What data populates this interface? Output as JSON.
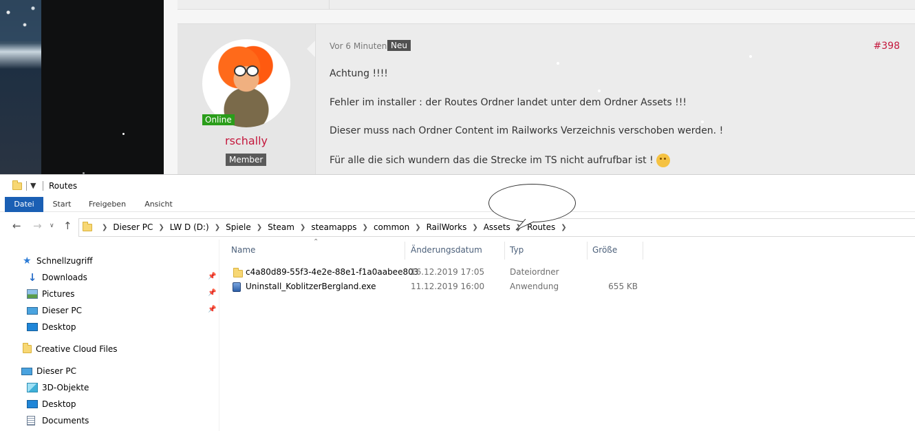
{
  "forum": {
    "post_time": "Vor 6 Minuten",
    "post_badge": "Neu",
    "post_number": "#398",
    "lines": [
      "Achtung !!!!",
      "Fehler im installer : der Routes Ordner landet unter dem Ordner Assets !!!",
      "Dieser muss nach Ordner Content im Railworks Verzeichnis verschoben werden. !",
      "Für alle die sich wundern das die Strecke im TS nicht aufrufbar ist !"
    ],
    "user": {
      "name": "rschally",
      "status": "Online",
      "role": "Member"
    },
    "colors": {
      "accent": "#c4173c",
      "online": "#2a9d1a"
    }
  },
  "explorer": {
    "window_title": "Routes",
    "ribbon_tabs": [
      "Datei",
      "Start",
      "Freigeben",
      "Ansicht"
    ],
    "breadcrumb": [
      "Dieser PC",
      "LW D (D:)",
      "Spiele",
      "Steam",
      "steamapps",
      "common",
      "RailWorks",
      "Assets",
      "Routes"
    ],
    "nav_pane": {
      "quick_access_label": "Schnellzugriff",
      "quick_access_items": [
        {
          "label": "Downloads",
          "icon": "download-icon",
          "pinned": true
        },
        {
          "label": "Pictures",
          "icon": "pictures-icon",
          "pinned": true
        },
        {
          "label": "Dieser PC",
          "icon": "computer-icon",
          "pinned": true
        },
        {
          "label": "Desktop",
          "icon": "desktop-icon",
          "pinned": false
        }
      ],
      "creative_cloud_label": "Creative Cloud Files",
      "this_pc_label": "Dieser PC",
      "this_pc_items": [
        {
          "label": "3D-Objekte",
          "icon": "cube-icon"
        },
        {
          "label": "Desktop",
          "icon": "desktop-icon"
        },
        {
          "label": "Documents",
          "icon": "document-icon"
        }
      ]
    },
    "columns": [
      "Name",
      "Änderungsdatum",
      "Typ",
      "Größe"
    ],
    "files": [
      {
        "name": "c4a80d89-55f3-4e2e-88e1-f1a0aabee803",
        "date": "16.12.2019 17:05",
        "type": "Dateiordner",
        "size": "",
        "icon": "folder-icon"
      },
      {
        "name": "Uninstall_KoblitzerBergland.exe",
        "date": "11.12.2019 16:00",
        "type": "Anwendung",
        "size": "655 KB",
        "icon": "exe-icon"
      }
    ],
    "colors": {
      "ribbon_active": "#1a5fb4",
      "column_header": "#4c607a"
    }
  }
}
